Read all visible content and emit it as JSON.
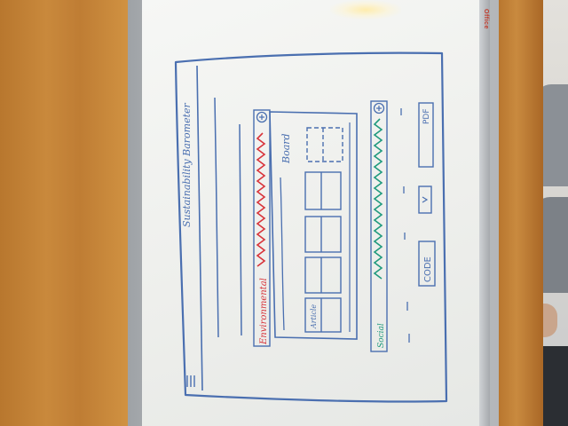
{
  "photo": {
    "surroundings": {
      "wood_color": "#c4843a",
      "board_color": "#f1f2ef"
    },
    "whiteboard_brand": "Office"
  },
  "sketch": {
    "title": "Sustainability Barometer",
    "environmental_label": "Environmental",
    "environmental_icon": "plus-circle-icon",
    "board_label": "Board",
    "article_label": "Article",
    "social_label": "Social",
    "social_icon": "plus-circle-icon",
    "pdf_button": "PDF",
    "code_button": "CODE",
    "menu_icon": "hamburger-icon",
    "colors": {
      "ink": "#4a6fb0",
      "environmental": "#d8333a",
      "social": "#1f9a7d"
    }
  }
}
